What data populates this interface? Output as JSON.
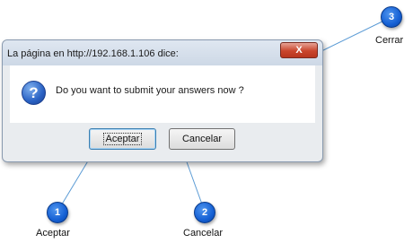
{
  "dialog": {
    "title": "La página en http://192.168.1.106 dice:",
    "close_glyph": "X",
    "message": "Do you want to submit your answers now ?",
    "question_glyph": "?",
    "accept_label": "Aceptar",
    "cancel_label": "Cancelar"
  },
  "callouts": [
    {
      "number": "1",
      "label": "Aceptar"
    },
    {
      "number": "2",
      "label": "Cancelar"
    },
    {
      "number": "3",
      "label": "Cerrar"
    }
  ],
  "colors": {
    "callout": "#1560d4",
    "close_button": "#c9452c",
    "leader_line": "#5b9bd5"
  },
  "icons": [
    "question-icon",
    "close-icon"
  ]
}
